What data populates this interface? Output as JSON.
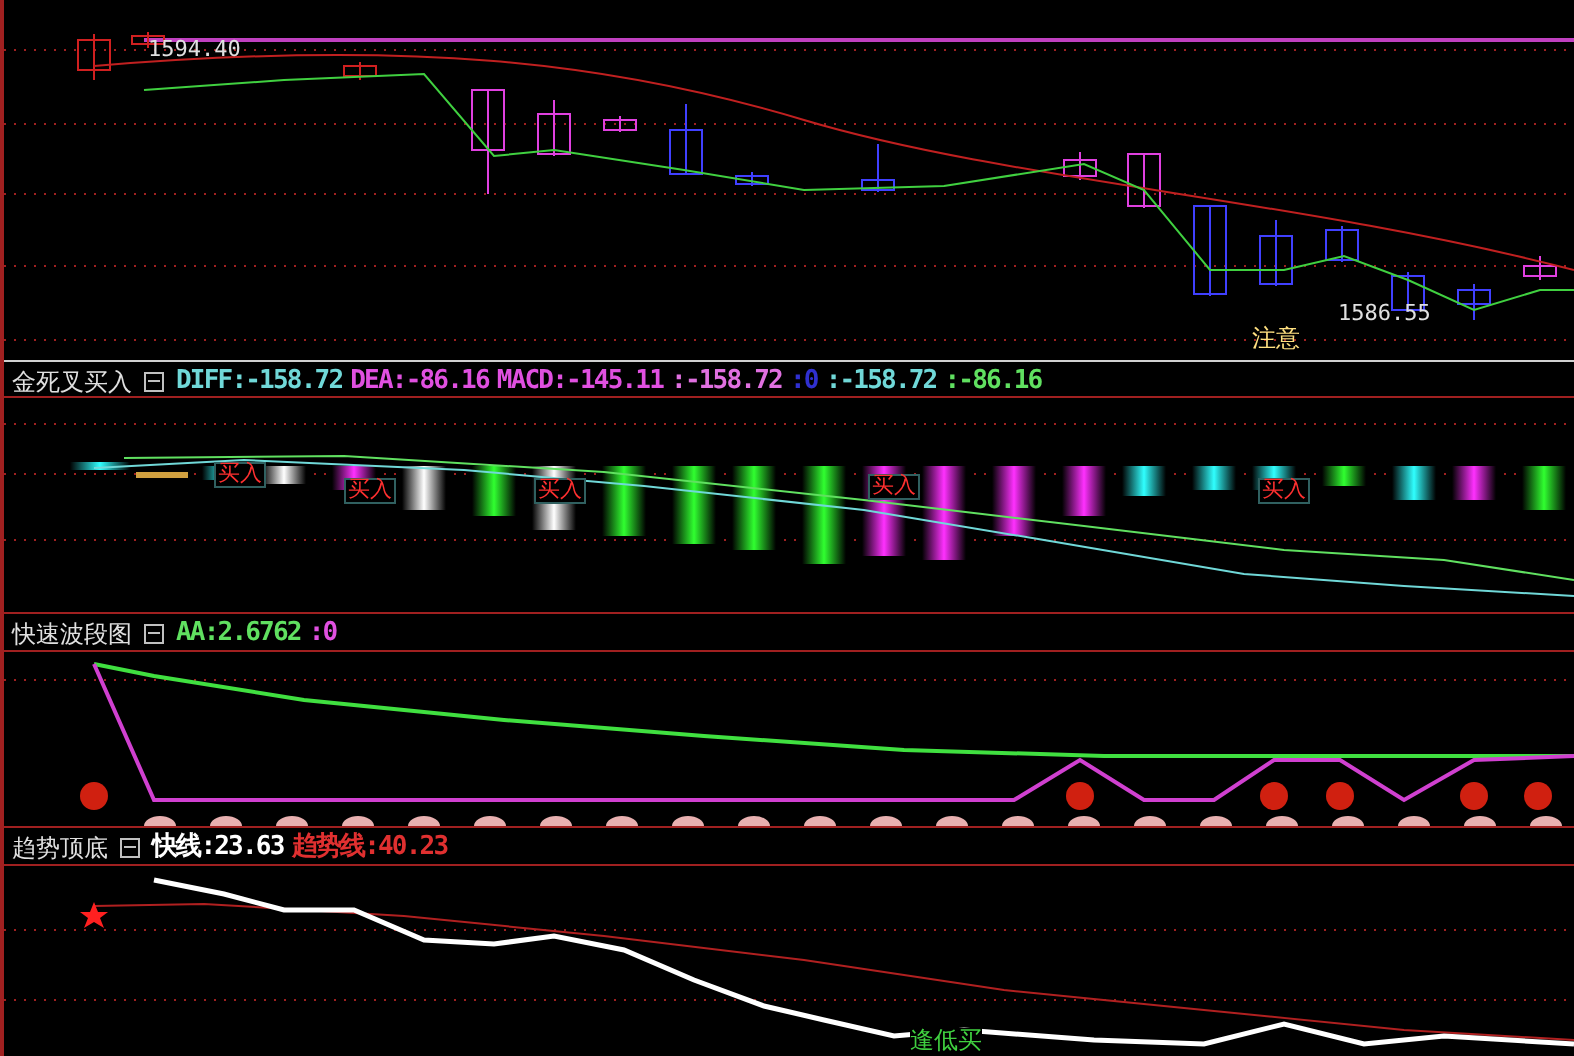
{
  "price_panel": {
    "high_label": "1594.40",
    "low_label": "1586.55",
    "signal": "注意"
  },
  "macd_panel": {
    "title": "金死叉买入",
    "readouts": [
      {
        "text": "DIFF:-158.72",
        "color": "#70d8d8"
      },
      {
        "text": "DEA:-86.16",
        "color": "#e050e0"
      },
      {
        "text": "MACD:-145.11",
        "color": "#e050e0"
      },
      {
        "text": ":-158.72",
        "color": "#e070e0"
      },
      {
        "text": ":0",
        "color": "#3030d0"
      },
      {
        "text": ":-158.72",
        "color": "#70d8d8"
      },
      {
        "text": ":-86.16",
        "color": "#60e060"
      }
    ],
    "signals": [
      "买入",
      "买入",
      "买入",
      "买入",
      "买入"
    ]
  },
  "wave_panel": {
    "title": "快速波段图",
    "readouts": [
      {
        "text": "AA:2.6762",
        "color": "#60e060"
      },
      {
        "text": ":0",
        "color": "#e050e0"
      }
    ]
  },
  "trend_panel": {
    "title": "趋势顶底",
    "readouts": [
      {
        "text": "快线:23.63",
        "color": "#ffffff"
      },
      {
        "text": "趋势线:40.23",
        "color": "#e03030"
      }
    ],
    "signal": "逢低买"
  }
}
